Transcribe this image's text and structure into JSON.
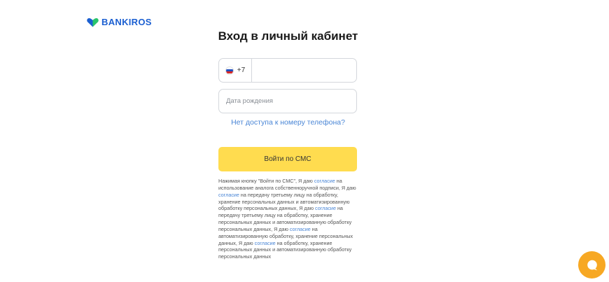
{
  "brand": {
    "name": "BANKIROS",
    "colors": {
      "blue": "#1b5fd1",
      "green": "#29c46b"
    }
  },
  "login": {
    "title": "Вход в личный кабинет",
    "phone": {
      "country": "ru-flag",
      "dial_code": "+7",
      "value": ""
    },
    "birthdate": {
      "placeholder": "Дата рождения",
      "value": ""
    },
    "no_access_link": "Нет доступа к номеру телефона?",
    "submit_label": "Войти по СМС",
    "accent_color": "#ffdc4f"
  },
  "consent": {
    "t1": "Нажимая кнопку \"Войти по СМС\", Я даю ",
    "link": "согласие",
    "t2": " на использование аналога собственноручной подписи, Я даю ",
    "t3": " на передачу третьему лицу на обработку, хранение персональных данных и автоматизированную обработку персональных данных, Я даю ",
    "t4": " на передачу третьему лицу на обработку, хранение персональных данных и автоматизированную обработку персональных данных, Я даю ",
    "t5": " на автоматизированную обработку, хранение персональных данных, Я даю ",
    "t6": " на обработку, хранение персональных данных и автоматизированную обработку персональных данных"
  },
  "chat": {
    "icon": "chat-bubble-icon",
    "color": "#f7a823"
  }
}
